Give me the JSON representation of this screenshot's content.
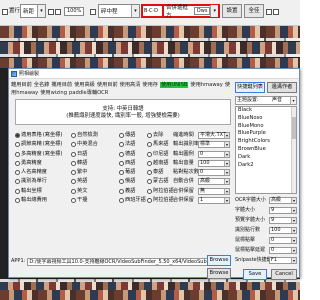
{
  "toolbar": {
    "left_label": "置行",
    "left_combo": "新距",
    "check1": "",
    "spin_value": "100",
    "spin_unit": "%",
    "mid_text": "碎中程",
    "highlight_combo": "合併邊框方",
    "dropdown_value": "Ows",
    "btn_settings": "設置",
    "btn_fullscreen": "全佳"
  },
  "dialog": {
    "title": "照相繪製",
    "presets": [
      "離用目前",
      "全名錄",
      "攜用目前",
      "使用高級",
      "使用目前",
      "使用高清",
      "使用存",
      "使用UNISB",
      "使用hmaway",
      "使用hmaway",
      "使用wizing",
      "paddle專輔OCR"
    ],
    "preset_highlight_index": 7,
    "support_line1": "支持: 中英日韓語",
    "support_line2": "(推薦識別速度最快, 識別率一般, 增強雙檢需要)",
    "options": [
      {
        "a": "適用表格",
        "a_note": "(寫坐標)",
        "a_on": true,
        "b": "自然檢測",
        "c": "傳語",
        "d": "去除",
        "e_label": "縮進時間",
        "e_value": "平滑大.TXT"
      },
      {
        "a": "調節高精",
        "a_note": "(寫坐標)",
        "a_on": false,
        "b": "中英混合",
        "c": "法語",
        "d": "馬來語",
        "e_label": "輸出識別率",
        "e_value": "標準"
      },
      {
        "a": "多高精度",
        "a_note": "(寫坐標)",
        "a_on": false,
        "b": "日語",
        "c": "德語",
        "d": "印尼語",
        "e_label": "輸出圖例",
        "e_value": "0"
      },
      {
        "a": "勇高精度",
        "a_note": "",
        "a_on": false,
        "b": "韓語",
        "c": "西語",
        "d": "越南語",
        "e_label": "輸出音量",
        "e_value": "100"
      },
      {
        "a": "人名高精度",
        "a_note": "",
        "a_on": false,
        "b": "繁中",
        "c": "葡語",
        "d": "泰語",
        "e_label": "點對點次數",
        "e_value": "0"
      },
      {
        "a": "識別為單行",
        "a_note": "",
        "a_on": false,
        "b": "英語",
        "c": "俄語",
        "d": "蒙古語",
        "e_label": "自動合併",
        "e_value": "高級"
      },
      {
        "a": "輸出坐標",
        "a_note": "",
        "a_on": false,
        "b": "英文",
        "c": "義語",
        "d": "阿拉伯語",
        "e_label": "合併保留",
        "e_value": "無"
      },
      {
        "a": "輸出總費用",
        "a_note": "",
        "a_on": false,
        "b": "干擾",
        "c": "西班牙語",
        "d": "阿拉伯語",
        "e_label": "合併保留",
        "e_value": "1"
      }
    ],
    "app_label": "APP1:",
    "app_path": "D:/便字幕視頻工具10.0-支持離線OCR/VideoSubFinder_5.50_x64/VideoSubFinder/",
    "browse_label": "Browse",
    "right": {
      "btn_shortcut_list": "快捷鍵列表",
      "btn_shortcut_code": "邊溝作者",
      "template_label": "主題設置:",
      "template_value": "声音",
      "items": [
        "Black",
        "BlueNoso",
        "BlueMono",
        "BluePurple",
        "BrightColors",
        "BrownBlue",
        "Dark",
        "Dark2"
      ],
      "fields": [
        {
          "label": "OCR字體大小",
          "value": "高級"
        },
        {
          "label": "字體大小",
          "value": "9"
        },
        {
          "label": "預覽字體大小",
          "value": "9"
        },
        {
          "label": "識別點行數",
          "value": "100"
        },
        {
          "label": "鼠標點擊",
          "value": "0"
        },
        {
          "label": "鼠標點擊延遲",
          "value": "0"
        },
        {
          "label": "Snipaste快捷鍵",
          "value": "F1"
        }
      ],
      "save_label": "Save",
      "cancel_label": "Cancel"
    }
  }
}
